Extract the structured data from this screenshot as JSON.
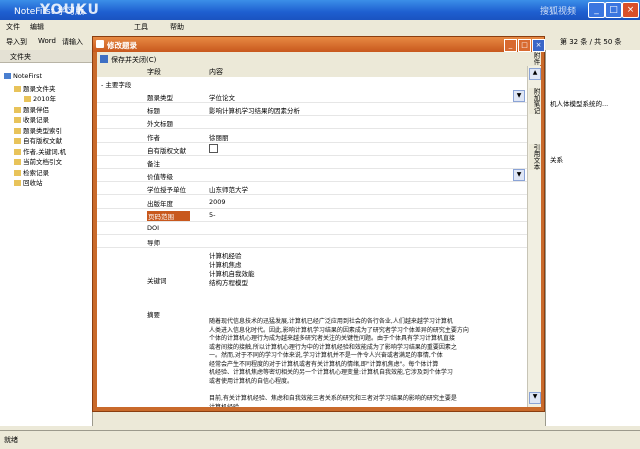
{
  "window": {
    "title": "NoteFirst 学习版",
    "watermark": "YOUKU",
    "watermark2": "搜狐视频"
  },
  "menu": {
    "items": [
      "文件",
      "编辑",
      "工具",
      "帮助"
    ]
  },
  "toolbar": {
    "import_label": "导入到",
    "word_label": "Word",
    "insert_label": "请输入",
    "page_info": "第 32 条 / 共 50 条"
  },
  "left_panel": {
    "header": "文件夹",
    "tree": [
      {
        "label": "NoteFirst",
        "level": 0
      },
      {
        "label": "题录文件夹",
        "level": 1
      },
      {
        "label": "2010年",
        "level": 2
      },
      {
        "label": "题录伴侣",
        "level": 1
      },
      {
        "label": "收录记录",
        "level": 1
      },
      {
        "label": "题录类型索引",
        "level": 1
      },
      {
        "label": "自有版权文献",
        "level": 1
      },
      {
        "label": "作者,关键词,机",
        "level": 1
      },
      {
        "label": "当前文档引文",
        "level": 1
      },
      {
        "label": "检索记录",
        "level": 1
      },
      {
        "label": "回收站",
        "level": 1
      }
    ]
  },
  "right_panel": {
    "rows": [
      "机人体模型系统的...",
      "关系"
    ]
  },
  "status": {
    "text": "就绪"
  },
  "dialog": {
    "title": "修改题录",
    "save_label": "保存并关闭(C)",
    "col_field": "字段",
    "col_content": "内容",
    "section": "- 主要字段",
    "side_tabs": [
      "附件",
      "附加笔记",
      "引用文本"
    ],
    "rows": [
      {
        "field": "题录类型",
        "value": "学位论文",
        "dropdown": true
      },
      {
        "field": "标题",
        "value": "影响计算机学习结果的因素分析"
      },
      {
        "field": "外文标题",
        "value": ""
      },
      {
        "field": "作者",
        "value": "徐丽丽"
      },
      {
        "field": "自有版权文献",
        "value": "",
        "checkbox": true
      },
      {
        "field": "备注",
        "value": ""
      },
      {
        "field": "价值等级",
        "value": "",
        "dropdown": true
      },
      {
        "field": "学位授予单位",
        "value": "山东师范大学"
      },
      {
        "field": "出版年度",
        "value": "2009"
      },
      {
        "field": "页码范围",
        "value": "5-",
        "selected": true
      },
      {
        "field": "DOI",
        "value": ""
      },
      {
        "field": "导师",
        "value": ""
      }
    ],
    "keywords_label": "关键词",
    "keywords": [
      "计算机经验",
      "计算机焦虑",
      "计算机自我效能",
      "结构方程模型"
    ],
    "abstract_label": "摘要",
    "abstract_lines": [
      "随着现代信息技术的迅猛发展,计算机已经广泛应用到社会的各行各业,人们越来越学习计算机",
      "人类进入信息化时代。因此,影响计算机学习结果的因素成为了研究者学习个体差异的研究主要方向",
      "个体的计算机心理行为成为越来越多研究者关注的关键性问题。由于个体具有学习计算机直接",
      "或者间接的接触,所以计算机心理行为中的计算机经验和效能成为了影响学习结果的重要因素之",
      "一。然而,对于不同的学习个体来说,学习计算机并不是一件令人兴奋或者满足的事情,个体",
      "经常会产生不同程度的对于计算机或者有关计算机的情绪,即\"计算机焦虑\"。每个体计算",
      "机经验、计算机焦虑等密切相关的另一个计算机心理变量:计算机自我效能,它涉及到个体学习",
      "或者使用计算机的自信心程度。"
    ],
    "abstract_lines2": [
      "目前,有关计算机经验、焦虑和自我效能三者关系的研究和三者对学习结果的影响的研究主要是",
      "计算机经验"
    ]
  },
  "colors": {
    "dialog_accent": "#c8581d",
    "titlebar": "#1e5fd0"
  }
}
